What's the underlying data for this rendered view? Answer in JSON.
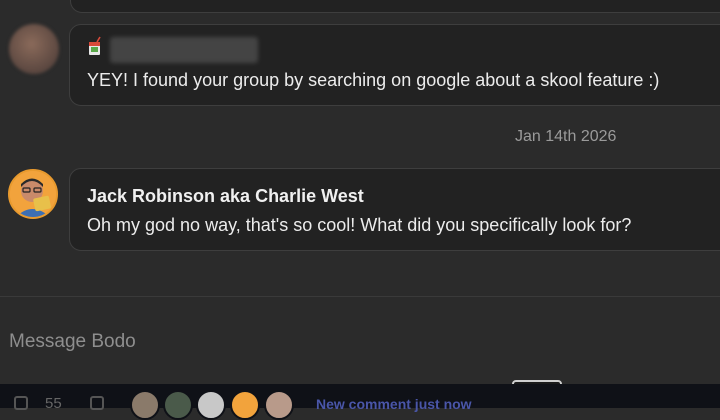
{
  "messages": [
    {
      "sender": "",
      "sender_icon": "juice-box-emoji-icon",
      "text": "YEY! I found your group by searching on google about a skool feature :)"
    },
    {
      "sender": "Jack Robinson aka Charlie West",
      "text": "Oh my god no way, that's so cool! What did you specifically look for?"
    }
  ],
  "date_separator": "Jan 14th 2026",
  "composer": {
    "placeholder": "Message Bodo"
  },
  "bottom_bar": {
    "comment_count": "55",
    "notice": "New comment just now"
  },
  "colors": {
    "background": "#2b2b2b",
    "bubble": "#222222",
    "avatar_ring": "#f2a33c",
    "notice": "#4a56a8"
  }
}
